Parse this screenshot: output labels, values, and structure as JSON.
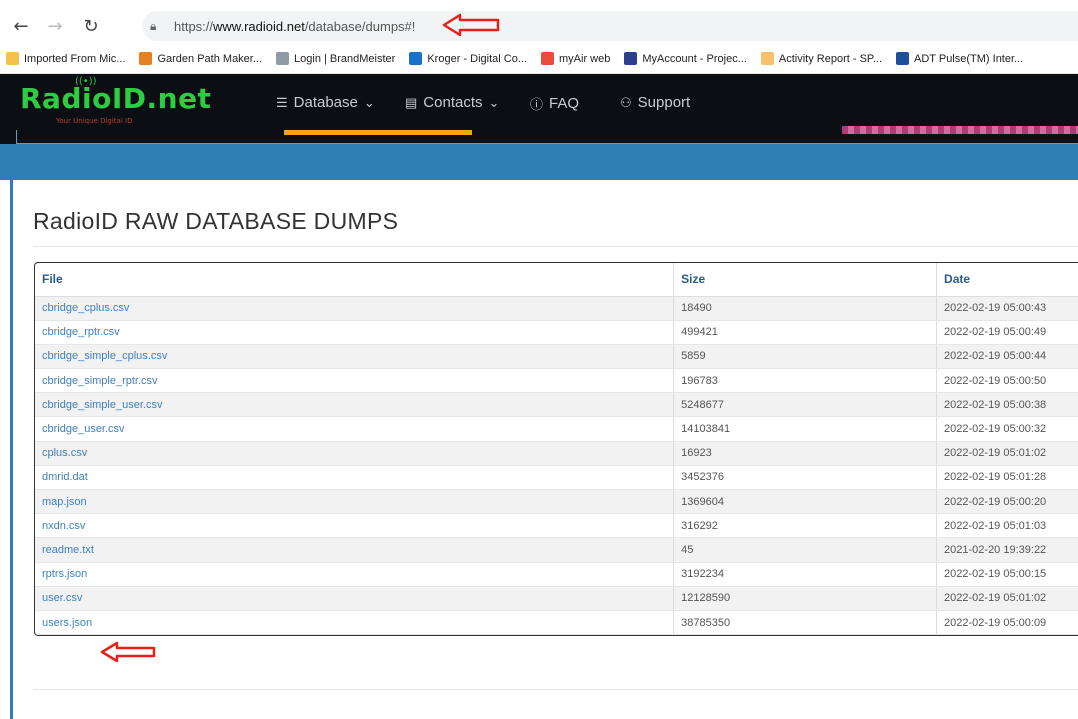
{
  "browser": {
    "url_prefix": "https://",
    "url_domain": "www.radioid.net",
    "url_path": "/database/dumps#!",
    "bookmarks": [
      {
        "label": "Imported From Mic...",
        "color": "#f2c14e"
      },
      {
        "label": "Garden Path Maker...",
        "color": "#e67e22"
      },
      {
        "label": "Login | BrandMeister",
        "color": "#8e9aa6"
      },
      {
        "label": "Kroger - Digital Co...",
        "color": "#1a73c9"
      },
      {
        "label": "myAir web",
        "color": "#e74c3c"
      },
      {
        "label": "MyAccount - Projec...",
        "color": "#2c3e8f"
      },
      {
        "label": "Activity Report - SP...",
        "color": "#f5c26b"
      },
      {
        "label": "ADT Pulse(TM) Inter...",
        "color": "#1f4e9c"
      }
    ]
  },
  "site": {
    "logo": "RadioID.net",
    "logo_tagline": "Your Unique Digital ID",
    "nav": {
      "database": "Database",
      "contacts": "Contacts",
      "faq": "FAQ",
      "support": "Support"
    }
  },
  "page": {
    "heading": "RadioID RAW DATABASE DUMPS"
  },
  "table": {
    "headers": {
      "file": "File",
      "size": "Size",
      "date": "Date"
    },
    "rows": [
      {
        "file": "cbridge_cplus.csv",
        "size": "18490",
        "date": "2022-02-19 05:00:43"
      },
      {
        "file": "cbridge_rptr.csv",
        "size": "499421",
        "date": "2022-02-19 05:00:49"
      },
      {
        "file": "cbridge_simple_cplus.csv",
        "size": "5859",
        "date": "2022-02-19 05:00:44"
      },
      {
        "file": "cbridge_simple_rptr.csv",
        "size": "196783",
        "date": "2022-02-19 05:00:50"
      },
      {
        "file": "cbridge_simple_user.csv",
        "size": "5248677",
        "date": "2022-02-19 05:00:38"
      },
      {
        "file": "cbridge_user.csv",
        "size": "14103841",
        "date": "2022-02-19 05:00:32"
      },
      {
        "file": "cplus.csv",
        "size": "16923",
        "date": "2022-02-19 05:01:02"
      },
      {
        "file": "dmrid.dat",
        "size": "3452376",
        "date": "2022-02-19 05:01:28"
      },
      {
        "file": "map.json",
        "size": "1369604",
        "date": "2022-02-19 05:00:20"
      },
      {
        "file": "nxdn.csv",
        "size": "316292",
        "date": "2022-02-19 05:01:03"
      },
      {
        "file": "readme.txt",
        "size": "45",
        "date": "2021-02-20 19:39:22"
      },
      {
        "file": "rptrs.json",
        "size": "3192234",
        "date": "2022-02-19 05:00:15"
      },
      {
        "file": "user.csv",
        "size": "12128590",
        "date": "2022-02-19 05:01:02"
      },
      {
        "file": "users.json",
        "size": "38785350",
        "date": "2022-02-19 05:00:09"
      }
    ]
  },
  "colors": {
    "annotation_arrow": "#e8201a",
    "site_nav_bg": "#0b0f14",
    "accent_blue": "#2f7fb6",
    "link_blue": "#3f7fbf"
  }
}
